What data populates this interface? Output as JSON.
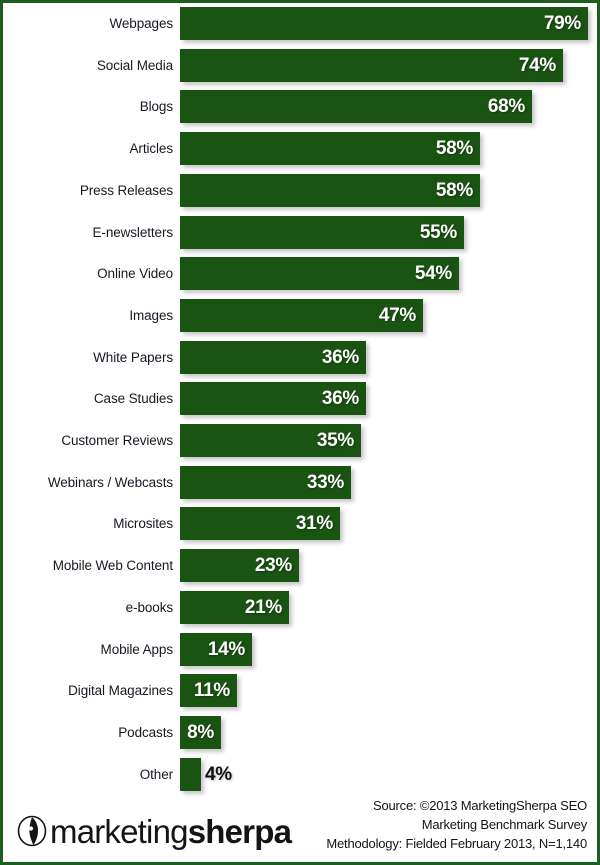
{
  "chart_data": {
    "type": "bar",
    "orientation": "horizontal",
    "title": "",
    "subtitle": "",
    "xlabel": "",
    "ylabel": "",
    "xlim": [
      0,
      80
    ],
    "grid": false,
    "legend": null,
    "value_suffix": "%",
    "categories": [
      "Webpages",
      "Social Media",
      "Blogs",
      "Articles",
      "Press Releases",
      "E-newsletters",
      "Online Video",
      "Images",
      "White Papers",
      "Case Studies",
      "Customer Reviews",
      "Webinars / Webcasts",
      "Microsites",
      "Mobile Web Content",
      "e-books",
      "Mobile Apps",
      "Digital Magazines",
      "Podcasts",
      "Other"
    ],
    "values": [
      79,
      74,
      68,
      58,
      58,
      55,
      54,
      47,
      36,
      36,
      35,
      33,
      31,
      23,
      21,
      14,
      11,
      8,
      4
    ],
    "labels": [
      "79%",
      "74%",
      "68%",
      "58%",
      "58%",
      "55%",
      "54%",
      "47%",
      "36%",
      "36%",
      "35%",
      "33%",
      "31%",
      "23%",
      "21%",
      "14%",
      "11%",
      "8%",
      "4%"
    ],
    "label_positions": [
      "inside",
      "inside",
      "inside",
      "inside",
      "inside",
      "inside",
      "inside",
      "inside",
      "inside",
      "inside",
      "inside",
      "inside",
      "inside",
      "inside",
      "inside",
      "inside",
      "inside",
      "inside",
      "outside"
    ],
    "bar_color": "#1a5412",
    "inside_label_color": "#ffffff",
    "outside_label_color": "#111111",
    "background_color": "#ffffff",
    "border_color": "#1b5e20"
  },
  "footer": {
    "logo": {
      "mark": "sherpa-compass-icon",
      "text_light": "marketing",
      "text_bold": "sherpa"
    },
    "source_lines": [
      "Source: ©2013 MarketingSherpa SEO",
      "Marketing Benchmark Survey",
      "Methodology: Fielded February 2013, N=1,140"
    ]
  }
}
